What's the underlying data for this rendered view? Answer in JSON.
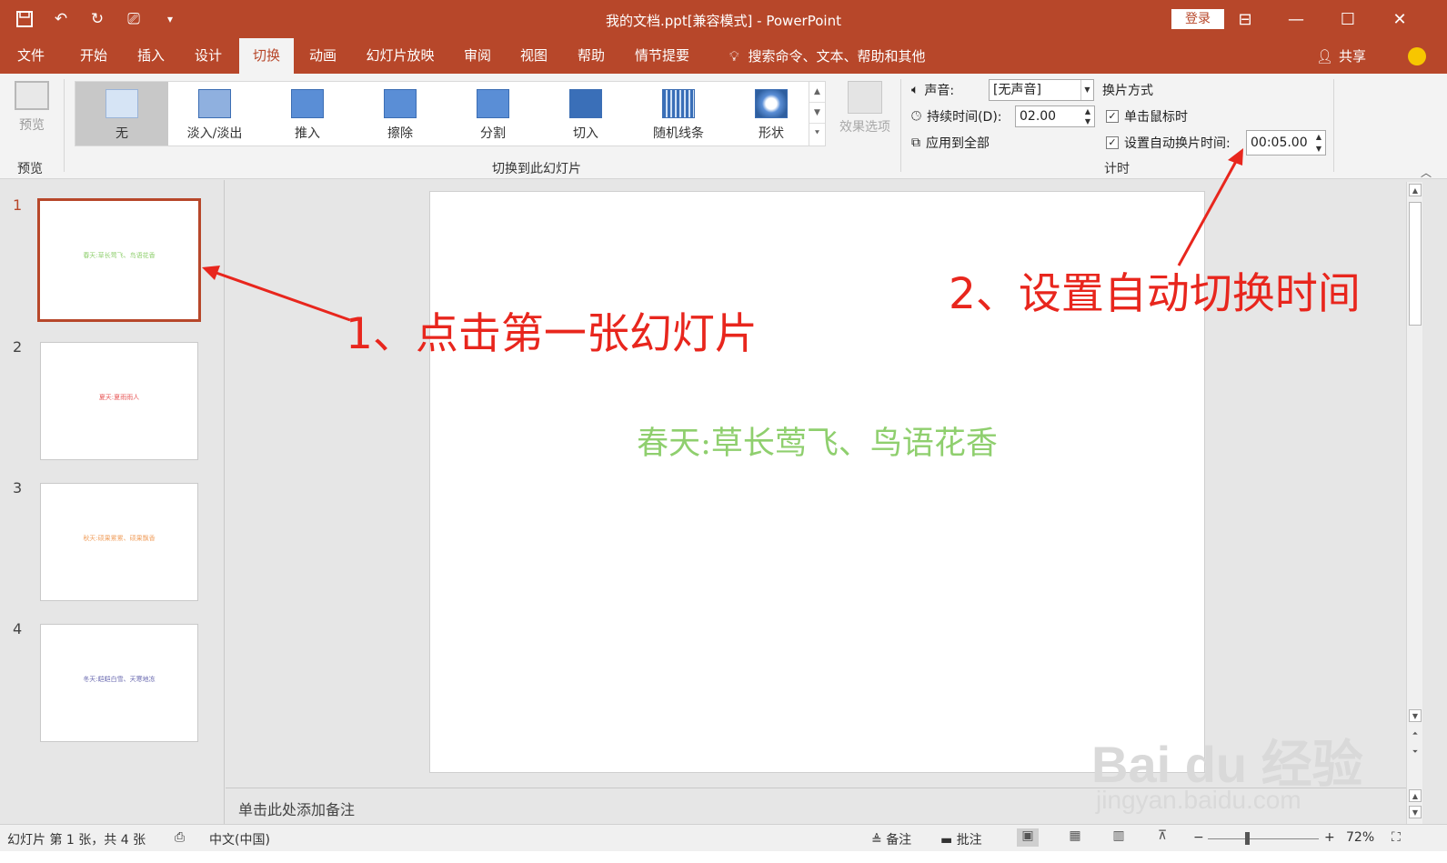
{
  "window": {
    "title": "我的文档.ppt[兼容模式]  -  PowerPoint",
    "login_label": "登录"
  },
  "tabs": [
    {
      "label": "文件"
    },
    {
      "label": "开始"
    },
    {
      "label": "插入"
    },
    {
      "label": "设计"
    },
    {
      "label": "切换",
      "active": true
    },
    {
      "label": "动画"
    },
    {
      "label": "幻灯片放映"
    },
    {
      "label": "审阅"
    },
    {
      "label": "视图"
    },
    {
      "label": "帮助"
    },
    {
      "label": "情节提要"
    }
  ],
  "tell_me": "搜索命令、文本、帮助和其他",
  "share_label": "共享",
  "ribbon": {
    "preview_label": "预览",
    "preview_group": "预览",
    "transitions": [
      {
        "label": "无"
      },
      {
        "label": "淡入/淡出"
      },
      {
        "label": "推入"
      },
      {
        "label": "擦除"
      },
      {
        "label": "分割"
      },
      {
        "label": "切入"
      },
      {
        "label": "随机线条"
      },
      {
        "label": "形状"
      }
    ],
    "effect_options": "效果选项",
    "transition_group": "切换到此幻灯片",
    "sound_label": "声音:",
    "sound_value": "[无声音]",
    "duration_label": "持续时间(D):",
    "duration_value": "02.00",
    "apply_all": "应用到全部",
    "advance_heading": "换片方式",
    "on_click": "单击鼠标时",
    "after_label": "设置自动换片时间:",
    "after_value": "00:05.00",
    "timing_group": "计时"
  },
  "slides": [
    {
      "num": "1",
      "text": "春天:草长莺飞、鸟语花香",
      "color": "#8fcf6e"
    },
    {
      "num": "2",
      "text": "夏天:夏雨雨人",
      "color": "#e85a5a"
    },
    {
      "num": "3",
      "text": "秋天:硕果累累、硕果飘香",
      "color": "#f0a060"
    },
    {
      "num": "4",
      "text": "冬天:皑皑白雪、天寒地冻",
      "color": "#6a6ab0"
    }
  ],
  "main_slide_text": "春天:草长莺飞、鸟语花香",
  "notes_placeholder": "单击此处添加备注",
  "status": {
    "slide_info": "幻灯片 第 1 张，共 4 张",
    "language": "中文(中国)",
    "notes_btn": "备注",
    "comments_btn": "批注",
    "zoom": "72%"
  },
  "annotations": {
    "step1": "1、点击第一张幻灯片",
    "step2": "2、设置自动切换时间"
  },
  "watermark": {
    "logo": "Bai du 经验",
    "url": "jingyan.baidu.com"
  },
  "colors": {
    "accent": "#b7472a",
    "annotation": "#e8261d"
  }
}
